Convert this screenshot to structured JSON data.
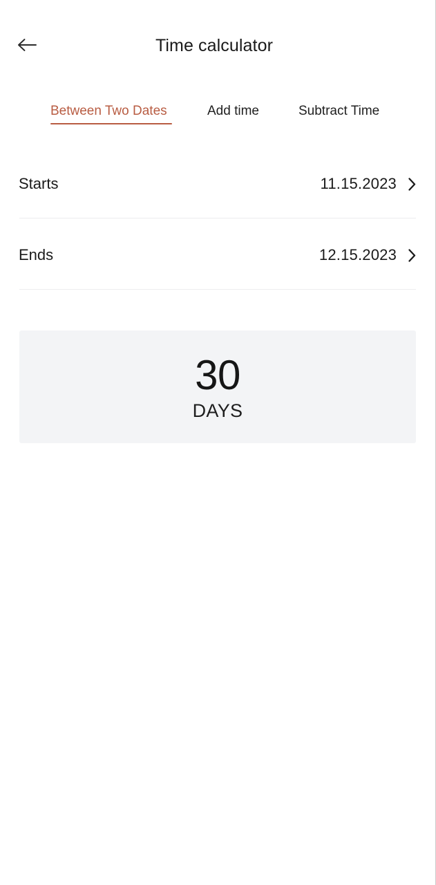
{
  "header": {
    "back_icon": "arrow-left-icon",
    "title": "Time calculator"
  },
  "tabs": {
    "active_index": 0,
    "accent_color": "#b85c42",
    "items": [
      {
        "label": "Between Two Dates"
      },
      {
        "label": "Add time"
      },
      {
        "label": "Subtract Time"
      }
    ]
  },
  "rows": [
    {
      "label": "Starts",
      "value": "11.15.2023",
      "chevron_icon": "chevron-right-icon"
    },
    {
      "label": "Ends",
      "value": "12.15.2023",
      "chevron_icon": "chevron-right-icon"
    }
  ],
  "result": {
    "value": "30",
    "unit": "DAYS",
    "background_color": "#f3f4f6"
  }
}
